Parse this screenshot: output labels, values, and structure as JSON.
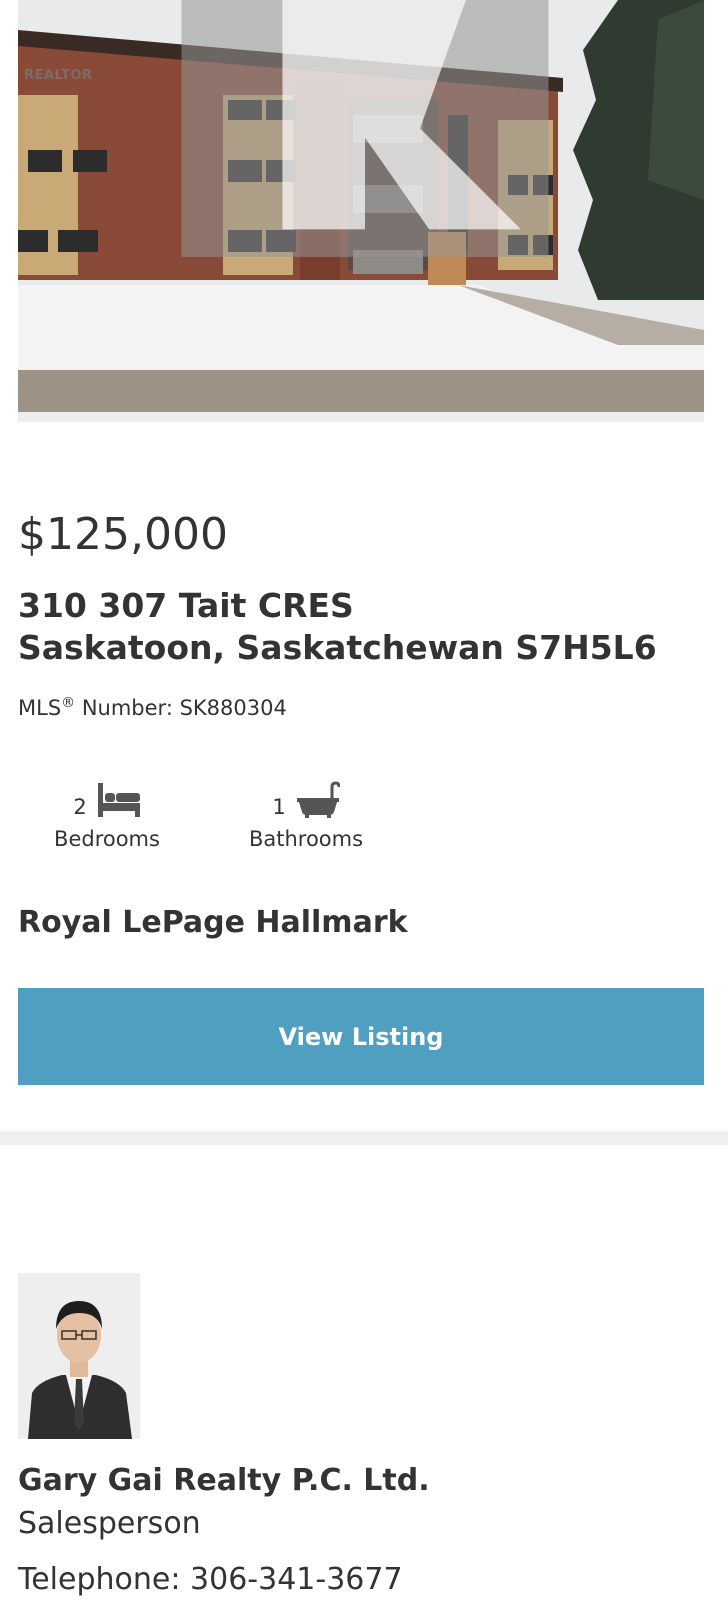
{
  "listing": {
    "photo_alt": "Apartment building exterior in winter",
    "watermark": "REALTOR",
    "price": "$125,000",
    "address_line1": "310 307 Tait CRES",
    "address_line2": "Saskatoon, Saskatchewan S7H5L6",
    "mls_prefix": "MLS",
    "mls_reg": "®",
    "mls_suffix": " Number: SK880304",
    "bedrooms_count": "2",
    "bedrooms_label": "Bedrooms",
    "bedrooms_icon": "bed-icon",
    "bathrooms_count": "1",
    "bathrooms_label": "Bathrooms",
    "bathrooms_icon": "bathtub-icon",
    "brokerage": "Royal LePage Hallmark",
    "view_button": "View Listing",
    "accent_color": "#4f9fc0"
  },
  "agent": {
    "name": "Gary Gai Realty P.C. Ltd.",
    "title": "Salesperson",
    "phone_label": "Telephone: ",
    "phone": "306-341-3677"
  }
}
